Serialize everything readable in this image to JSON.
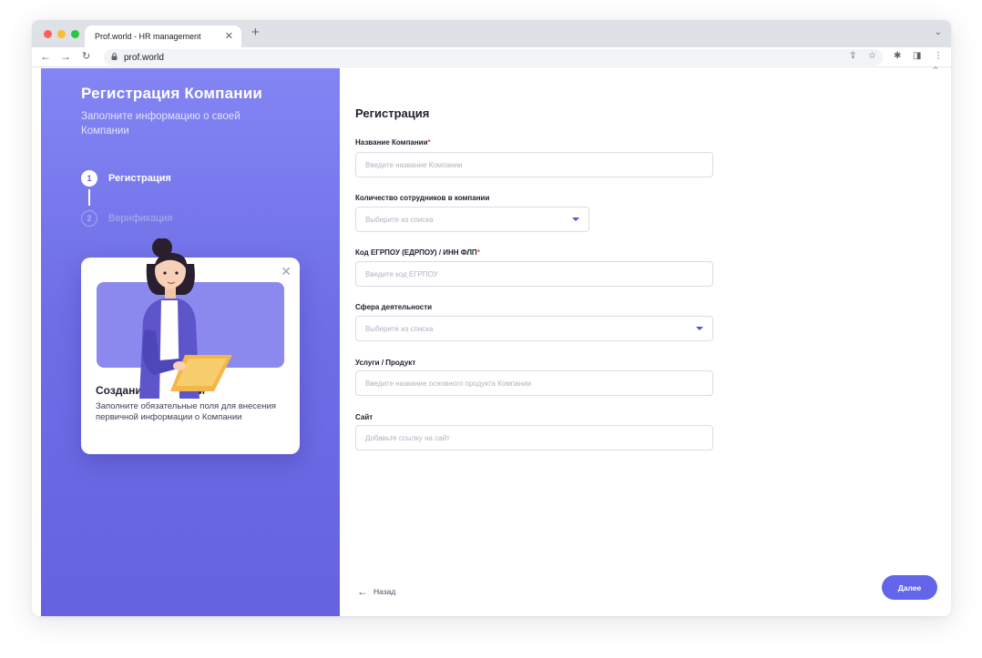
{
  "browser": {
    "tab_title": "Prof.world - HR management",
    "tab_close": "✕",
    "new_tab": "+",
    "tab_menu": "⌄",
    "url": "prof.world",
    "icons": [
      "back-icon",
      "forward-icon",
      "reload-icon",
      "lock-icon",
      "share-icon",
      "star-icon",
      "extensions-icon",
      "sidepanel-icon",
      "menu-icon"
    ]
  },
  "sidebar": {
    "title": "Регистрация Компании",
    "subtitle": "Заполните информацию о своей Компании",
    "steps": [
      {
        "number": "1",
        "label": "Регистрация",
        "active": true
      },
      {
        "number": "2",
        "label": "Верификация",
        "active": false
      }
    ],
    "card": {
      "title": "Создание Компании",
      "text": "Заполните обязательные поля для внесения первичной информации о Компании"
    }
  },
  "form": {
    "title": "Регистрация",
    "fields": [
      {
        "label": "Название Компании",
        "required": "*",
        "placeholder": "Введите название Компании",
        "type": "text"
      },
      {
        "label": "Количество сотрудников в компании",
        "required": "",
        "placeholder": "Выберите из списка",
        "type": "select"
      },
      {
        "label": "Код ЕГРПОУ (ЕДРПОУ)  / ИНН ФЛП",
        "required": "*",
        "placeholder": "Введите код ЕГРПОУ",
        "type": "text"
      },
      {
        "label": "Сфера деятельности",
        "required": "",
        "placeholder": "Выберите из списка",
        "type": "select"
      },
      {
        "label": "Услуги / Продукт",
        "required": "",
        "placeholder": "Введите название основного продукта Компании",
        "type": "text"
      },
      {
        "label": "Сайт",
        "required": "",
        "placeholder": "Добавьте ссылку на сайт",
        "type": "text"
      }
    ],
    "back_label": "Назад",
    "next_label": "Далее"
  },
  "colors": {
    "accent": "#6366ea",
    "sidebar_top": "#8385f4",
    "sidebar_bottom": "#6662e0",
    "required": "#e24a4a"
  }
}
